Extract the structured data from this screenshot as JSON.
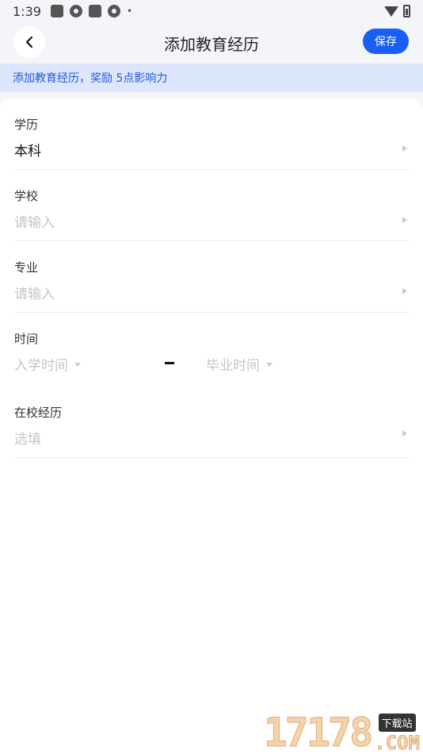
{
  "status_bar": {
    "time": "1:39",
    "dot": "•",
    "icons": [
      "app-square-icon",
      "pinwheel-icon",
      "app-square-icon",
      "pinwheel-icon",
      "wifi-icon",
      "battery-icon"
    ]
  },
  "nav": {
    "back_icon": "chevron-left-icon",
    "title": "添加教育经历",
    "save_label": "保存"
  },
  "banner": {
    "text": "添加教育经历，奖励 5点影响力"
  },
  "form": {
    "degree": {
      "label": "学历",
      "value": "本科"
    },
    "school": {
      "label": "学校",
      "placeholder": "请输入"
    },
    "major": {
      "label": "专业",
      "placeholder": "请输入"
    },
    "time": {
      "label": "时间",
      "start_placeholder": "入学时间",
      "end_placeholder": "毕业时间"
    },
    "experience": {
      "label": "在校经历",
      "placeholder": "选填"
    }
  },
  "watermark": {
    "digits": "17178",
    "tag": "下载站",
    "domain": ".COM"
  },
  "colors": {
    "accent": "#1a5ff5",
    "banner_bg": "#dde6fc",
    "banner_text": "#1f5adb",
    "placeholder": "#c3c5cc"
  }
}
